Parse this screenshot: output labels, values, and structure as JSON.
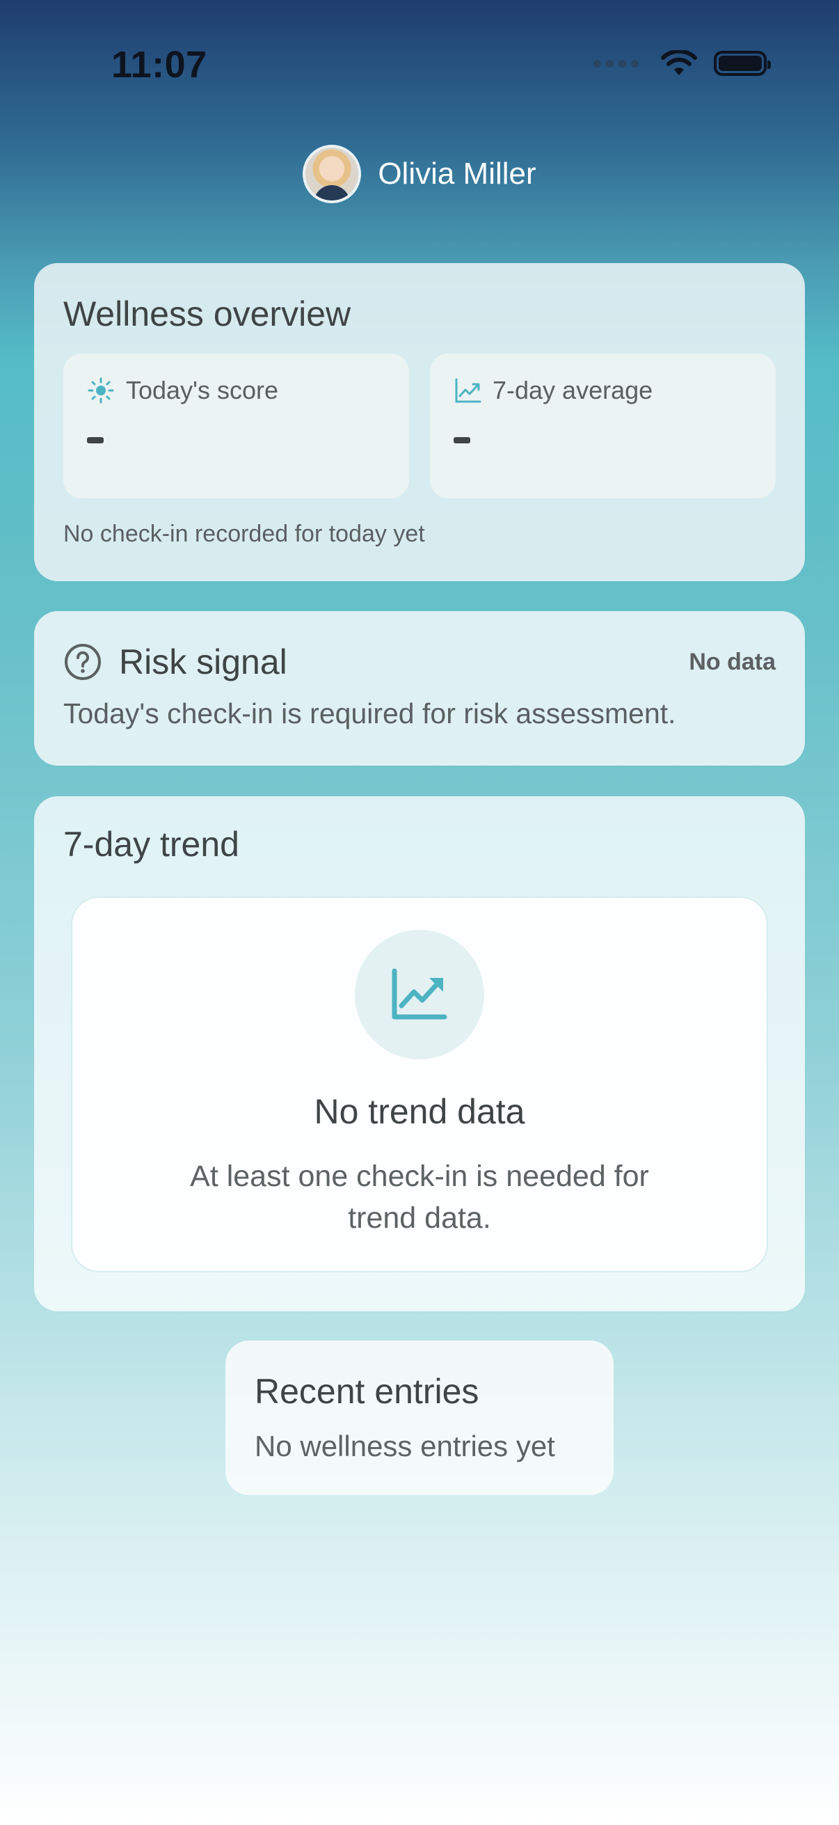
{
  "status_bar": {
    "time": "11:07"
  },
  "profile": {
    "name": "Olivia Miller"
  },
  "overview": {
    "title": "Wellness overview",
    "todays_score_label": "Today's score",
    "todays_score_value": "-",
    "avg_label": "7-day average",
    "avg_value": "-",
    "note": "No check-in recorded for today yet"
  },
  "risk": {
    "title": "Risk signal",
    "badge": "No data",
    "description": "Today's check-in is required for risk assessment."
  },
  "trend": {
    "title": "7-day trend",
    "empty_title": "No trend data",
    "empty_description": "At least one check-in is needed for trend data."
  },
  "recent": {
    "title": "Recent entries",
    "empty": "No wellness entries yet"
  },
  "colors": {
    "accent": "#4cb3c2",
    "text": "#3f4446"
  }
}
